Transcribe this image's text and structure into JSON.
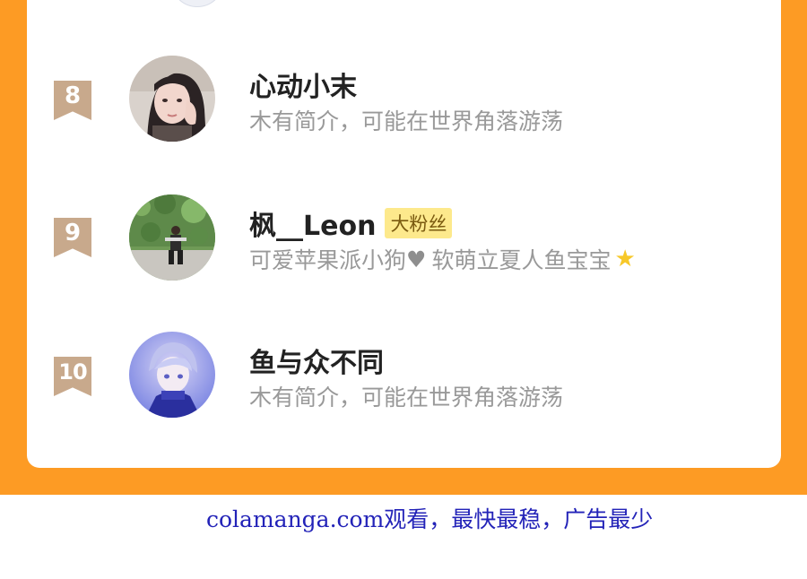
{
  "ranking": {
    "rows": [
      {
        "rank": "8",
        "name": "心动小末",
        "badge": "",
        "bio": "木有简介，可能在世界角落游荡",
        "avatar": "avatar-girl-photo"
      },
      {
        "rank": "9",
        "name": "枫__Leon",
        "badge": "大粉丝",
        "bio": "可爱苹果派小狗",
        "bio_tail": "软萌立夏人鱼宝宝",
        "avatar": "avatar-person-outdoor-photo"
      },
      {
        "rank": "10",
        "name": "鱼与众不同",
        "badge": "",
        "bio": "木有简介，可能在世界角落游荡",
        "avatar": "avatar-anime-boy"
      }
    ]
  },
  "footer": {
    "text": "colamanga.com观看，最快最稳，广告最少"
  },
  "colors": {
    "frame": "#fd9b24",
    "rank_badge": "#c8a98c",
    "fan_badge": "#fde98c",
    "link": "#2323b8"
  }
}
